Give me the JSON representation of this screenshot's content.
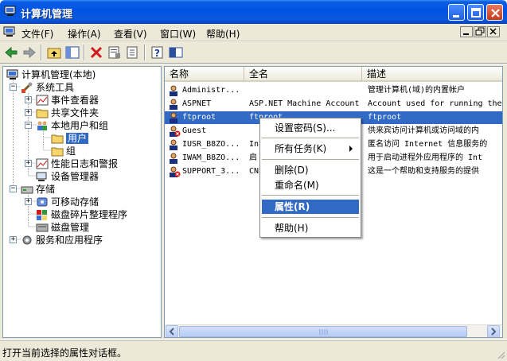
{
  "window": {
    "title": "计算机管理"
  },
  "menu": [
    "文件(F)",
    "操作(A)",
    "查看(V)",
    "窗口(W)",
    "帮助(H)"
  ],
  "tree": [
    {
      "label": "计算机管理(本地)",
      "level": 0,
      "expander": ""
    },
    {
      "label": "系统工具",
      "level": 1,
      "expander": "−"
    },
    {
      "label": "事件查看器",
      "level": 2,
      "expander": "+"
    },
    {
      "label": "共享文件夹",
      "level": 2,
      "expander": "+"
    },
    {
      "label": "本地用户和组",
      "level": 2,
      "expander": "−"
    },
    {
      "label": "用户",
      "level": 3,
      "expander": ""
    },
    {
      "label": "组",
      "level": 3,
      "expander": ""
    },
    {
      "label": "性能日志和警报",
      "level": 2,
      "expander": "+"
    },
    {
      "label": "设备管理器",
      "level": 2,
      "expander": ""
    },
    {
      "label": "存储",
      "level": 1,
      "expander": "−"
    },
    {
      "label": "可移动存储",
      "level": 2,
      "expander": "+"
    },
    {
      "label": "磁盘碎片整理程序",
      "level": 2,
      "expander": ""
    },
    {
      "label": "磁盘管理",
      "level": 2,
      "expander": ""
    },
    {
      "label": "服务和应用程序",
      "level": 1,
      "expander": "+"
    }
  ],
  "list": {
    "headers": [
      "名称",
      "全名",
      "描述"
    ],
    "rows": [
      {
        "name": "Administr...",
        "fullname": "",
        "desc": "管理计算机(域)的内置帐户"
      },
      {
        "name": "ASPNET",
        "fullname": "ASP.NET Machine Account",
        "desc": "Account used for running the"
      },
      {
        "name": "ftproot",
        "fullname": "ftproot",
        "desc": "ftproot"
      },
      {
        "name": "Guest",
        "fullname": "",
        "desc": "供来宾访问计算机或访问域的内"
      },
      {
        "name": "IUSR_B8ZO...",
        "fullname": "In",
        "desc": "匿名访问 Internet 信息服务的"
      },
      {
        "name": "IWAM_B8ZO...",
        "fullname": "启",
        "desc": "用于启动进程外应用程序的 Int"
      },
      {
        "name": "SUPPORT_3...",
        "fullname": "CN",
        "desc": "这是一个帮助和支持服务的提供"
      }
    ],
    "selected_index": 2
  },
  "context_menu": {
    "set_password": "设置密码(S)...",
    "all_tasks": "所有任务(K)",
    "delete": "删除(D)",
    "rename": "重命名(M)",
    "properties": "属性(R)",
    "help": "帮助(H)"
  },
  "status": "打开当前选择的属性对话框。"
}
